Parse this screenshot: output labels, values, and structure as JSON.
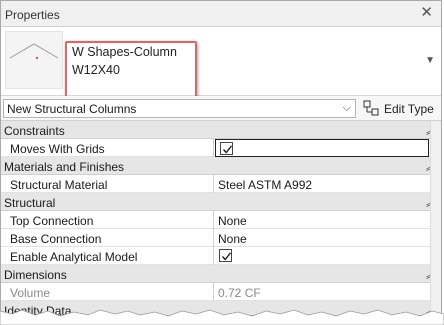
{
  "window": {
    "title": "Properties"
  },
  "type_selector": {
    "family": "W Shapes-Column",
    "type": "W12X40",
    "highlight_color": "#e06666"
  },
  "filter": {
    "selected": "New Structural Columns",
    "edit_type_label": "Edit Type"
  },
  "groups": {
    "constraints": {
      "label": "Constraints"
    },
    "materials": {
      "label": "Materials and Finishes"
    },
    "structural": {
      "label": "Structural"
    },
    "dimensions": {
      "label": "Dimensions"
    },
    "identity": {
      "label": "Identity Data"
    }
  },
  "properties": {
    "moves_with_grids": {
      "name": "Moves With Grids",
      "checked": true
    },
    "structural_material": {
      "name": "Structural Material",
      "value": "Steel ASTM A992"
    },
    "top_connection": {
      "name": "Top Connection",
      "value": "None"
    },
    "base_connection": {
      "name": "Base Connection",
      "value": "None"
    },
    "enable_analytical_model": {
      "name": "Enable Analytical Model",
      "checked": true
    },
    "volume": {
      "name": "Volume",
      "value": "0.72 CF"
    }
  }
}
